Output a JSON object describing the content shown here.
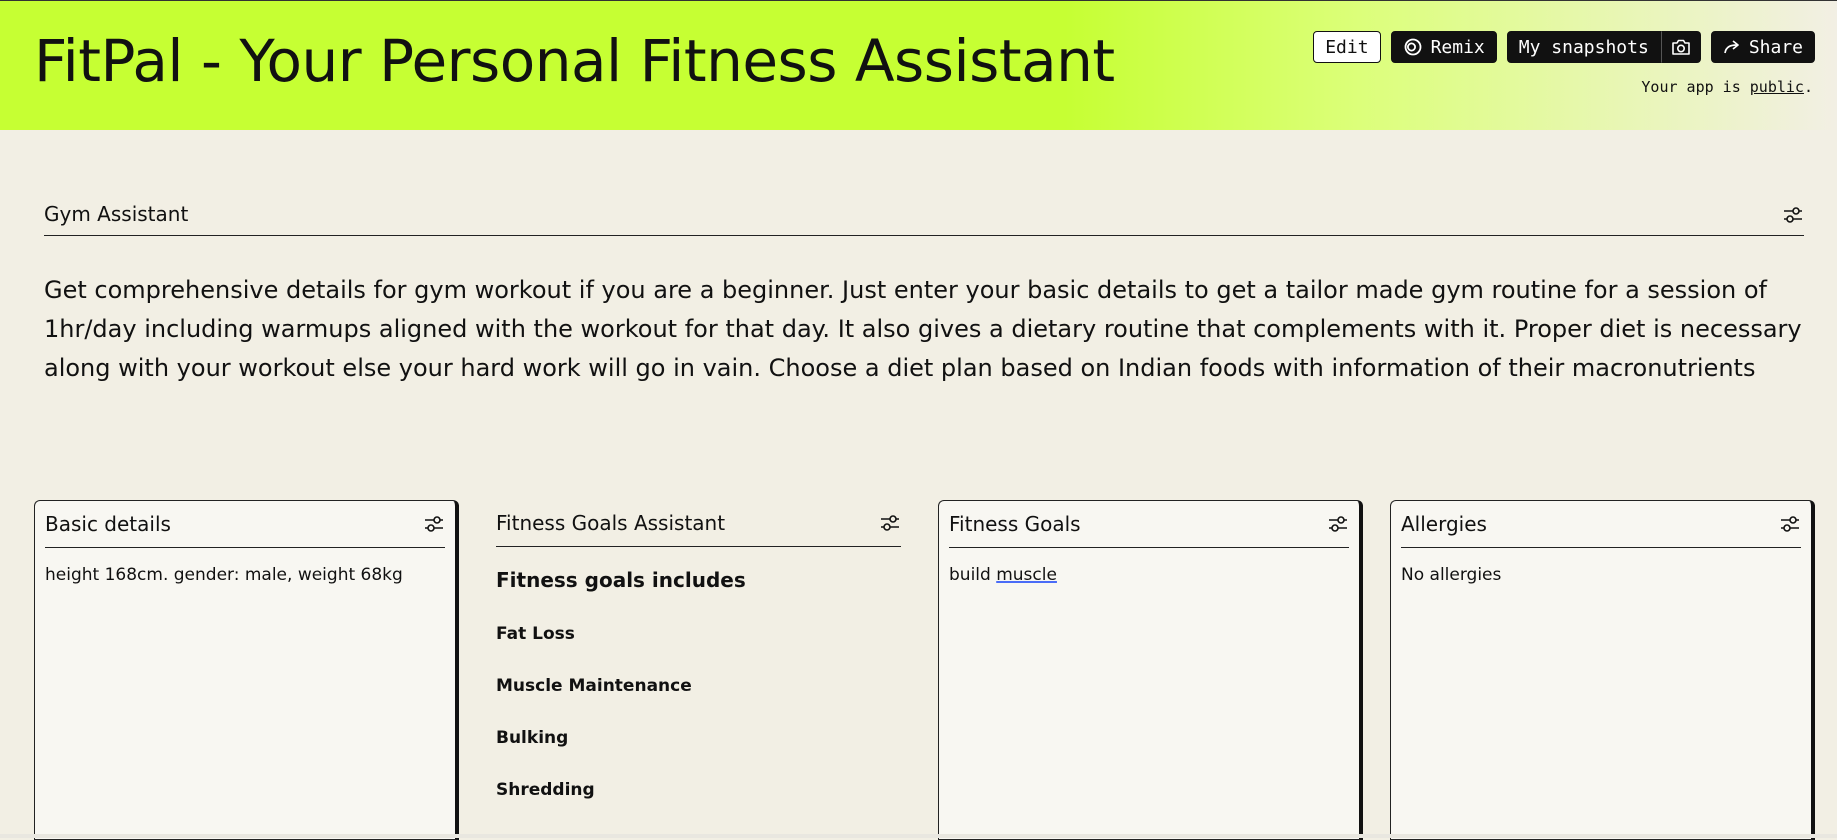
{
  "header": {
    "title": "FitPal - Your Personal Fitness Assistant",
    "buttons": {
      "edit": "Edit",
      "remix": "Remix",
      "snapshots": "My snapshots",
      "share": "Share"
    },
    "icons": {
      "remix": "remix-icon",
      "camera": "camera-icon",
      "share": "share-arrow-icon"
    },
    "public_note_prefix": "Your app is ",
    "public_link": "public",
    "public_note_suffix": ".",
    "colors": {
      "accent": "#c6ff33",
      "background": "#f2efe4",
      "button_dark": "#111111"
    }
  },
  "section": {
    "title": "Gym Assistant",
    "description": "Get comprehensive details for gym workout if you are a beginner. Just enter your basic details to get a tailor made gym routine for a session of 1hr/day including warmups aligned with the workout for that day. It also gives a dietary routine that complements with it. Proper diet is necessary along with your workout else your hard work will go in vain. Choose a diet plan based on Indian foods with information of their macronutrients"
  },
  "cards": {
    "basic_details": {
      "title": "Basic details",
      "value": "height 168cm. gender: male, weight 68kg"
    },
    "goals_assistant": {
      "title": "Fitness Goals Assistant",
      "heading": "Fitness goals includes",
      "items": [
        "Fat Loss",
        "Muscle Maintenance",
        "Bulking",
        "Shredding"
      ]
    },
    "fitness_goals": {
      "title": "Fitness Goals",
      "value_part1": "build ",
      "value_part2": "muscle"
    },
    "allergies": {
      "title": "Allergies",
      "value": "No allergies"
    }
  }
}
